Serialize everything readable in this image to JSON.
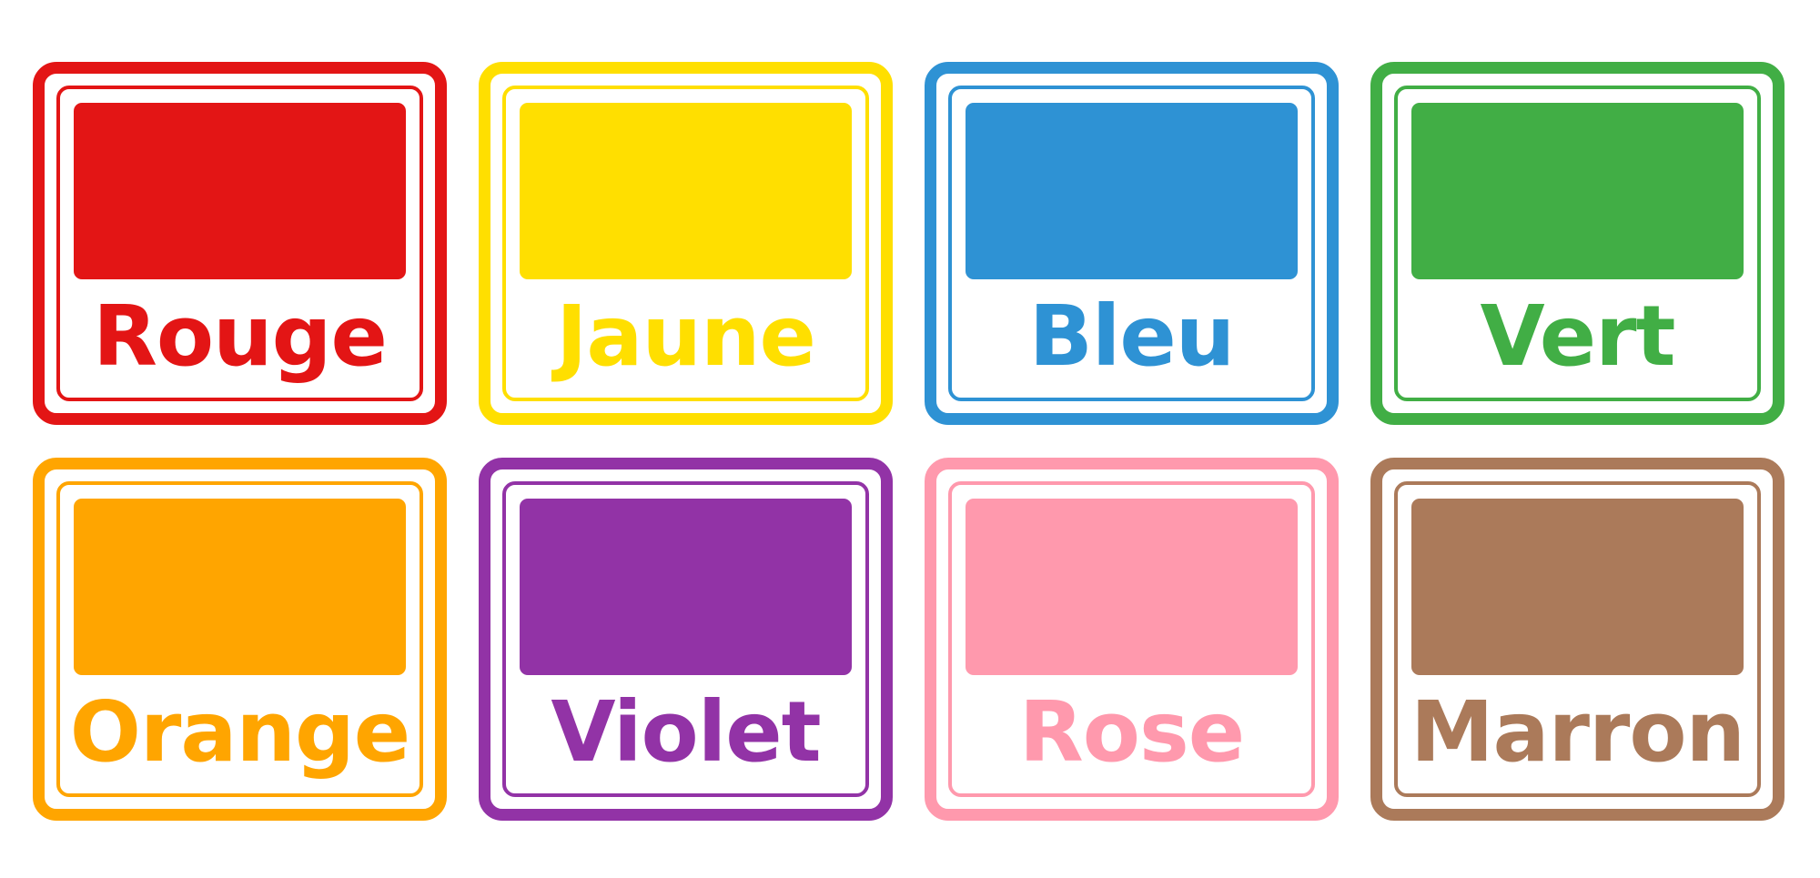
{
  "cards": [
    {
      "label": "Rouge",
      "color": "#e31515"
    },
    {
      "label": "Jaune",
      "color": "#ffdf00"
    },
    {
      "label": "Bleu",
      "color": "#2e92d4"
    },
    {
      "label": "Vert",
      "color": "#41ae45"
    },
    {
      "label": "Orange",
      "color": "#ffa500"
    },
    {
      "label": "Violet",
      "color": "#9233a6"
    },
    {
      "label": "Rose",
      "color": "#ff99ad"
    },
    {
      "label": "Marron",
      "color": "#ab7a5a"
    }
  ]
}
